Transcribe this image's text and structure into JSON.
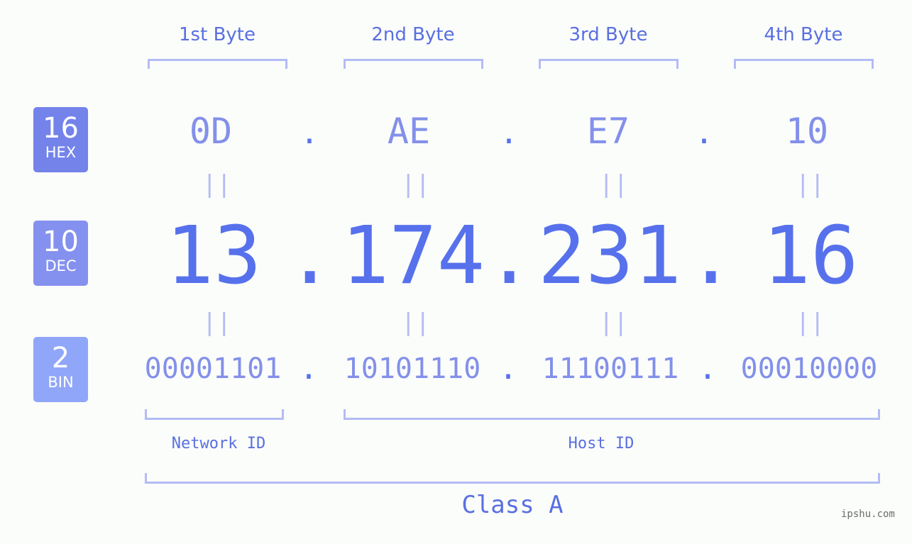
{
  "ip_address": "13.174.231.16",
  "byte_headers": [
    "1st Byte",
    "2nd Byte",
    "3rd Byte",
    "4th Byte"
  ],
  "badges": {
    "hex": {
      "base": "16",
      "label": "HEX",
      "color": "#7383ea"
    },
    "dec": {
      "base": "10",
      "label": "DEC",
      "color": "#8491ef"
    },
    "bin": {
      "base": "2",
      "label": "BIN",
      "color": "#90a6f8"
    }
  },
  "hex_values": [
    "0D",
    "AE",
    "E7",
    "10"
  ],
  "dec_values": [
    "13",
    "174",
    "231",
    "16"
  ],
  "bin_values": [
    "00001101",
    "10101110",
    "11100111",
    "00010000"
  ],
  "separator": ".",
  "equals_sign": "||",
  "segments": {
    "network_id": "Network ID",
    "host_id": "Host ID"
  },
  "ip_class": "Class A",
  "watermark": "ipshu.com",
  "colors": {
    "primary": "#5771ec",
    "secondary": "#8390ea",
    "bracket": "#b3bcf5",
    "label": "#5a6fe0",
    "background": "#fbfdfb"
  }
}
